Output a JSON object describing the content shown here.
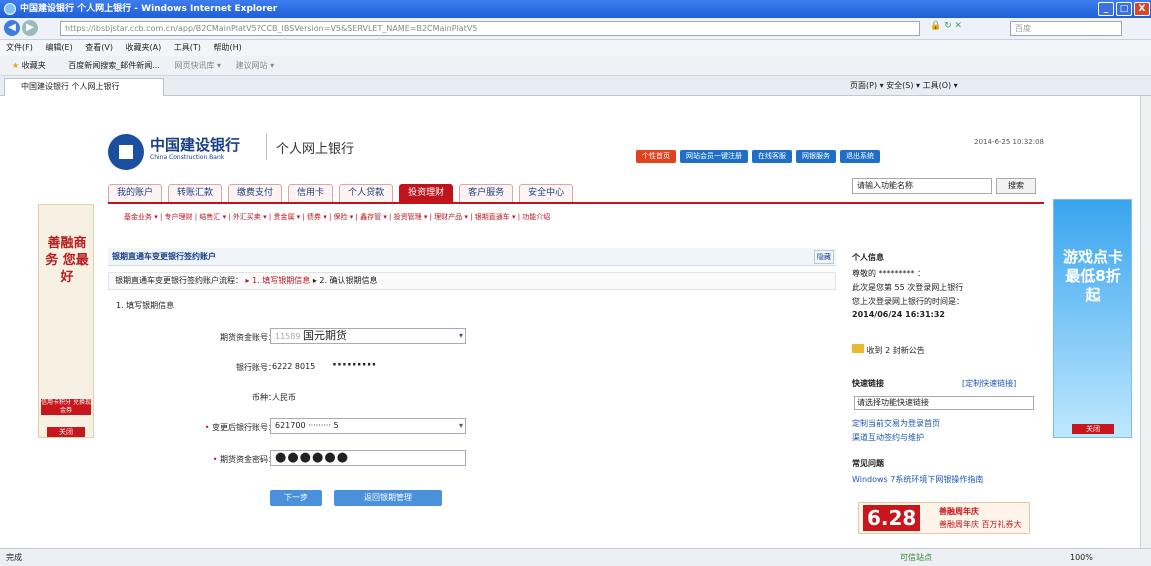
{
  "window": {
    "title": "中国建设银行 个人网上银行 - Windows Internet Explorer",
    "min": "_",
    "max": "□",
    "close": "X"
  },
  "address": {
    "url": "https://ibsbjstar.ccb.com.cn/app/B2CMainPlatV5?CCB_IBSVersion=V5&SERVLET_NAME=B2CMainPlatV5",
    "search_placeholder": "百度"
  },
  "menu": [
    "文件(F)",
    "编辑(E)",
    "查看(V)",
    "收藏夹(A)",
    "工具(T)",
    "帮助(H)"
  ],
  "favorites": {
    "label": "收藏夹",
    "items": [
      "百度新闻搜索_邮件新闻...",
      "网页快讯库 ▾",
      "建议网站 ▾"
    ]
  },
  "tab": {
    "label": "中国建设银行 个人网上银行",
    "tools": "页面(P) ▾  安全(S) ▾  工具(O) ▾"
  },
  "header": {
    "logo_cn": "中国建设银行",
    "logo_en": "China Construction Bank",
    "product": "个人网上银行",
    "datetime": "2014-6-25 10:32:08",
    "links": [
      "个性首页",
      "网站会员一键注册",
      "在线客服",
      "网银服务",
      "退出系统"
    ]
  },
  "mainnav": [
    "我的账户",
    "转账汇款",
    "缴费支付",
    "信用卡",
    "个人贷款",
    "投资理财",
    "客户服务",
    "安全中心"
  ],
  "function_search": {
    "placeholder": "请输入功能名称",
    "button": "搜索"
  },
  "subnav": "基金业务 ▾ | 专户理财 | 结售汇 ▾ | 外汇买卖 ▾ | 贵金属 ▾ | 债券 ▾ | 保险 ▾ | 鑫存管 ▾ | 投资管理 ▾ | 理财产品 ▾ | 银期直通车 ▾ | 功能介绍",
  "form": {
    "section_title": "银期直通车变更银行签约账户",
    "collapse": "隐藏",
    "flow_label": "银期直通车变更银行签约账户流程：",
    "flow_step1": "▸ 1. 填写银期信息",
    "flow_step2": "▸ 2. 确认银期信息",
    "step_title": "1. 填写银期信息",
    "futures_account_label": "期货资金账号：",
    "futures_account_value": "11589",
    "futures_company": "国元期货",
    "bank_account_label": "银行账号：",
    "bank_account_value": "6222 8015",
    "bank_account_mask": "·········",
    "currency_label": "币种：",
    "currency_value": "人民币",
    "new_account_label": "变更后银行账号：",
    "new_account_value": "621700 ········· 5",
    "password_label": "期货资金密码：",
    "password_value": "●●●●●●",
    "next_button": "下一步",
    "back_button": "返回银期管理"
  },
  "personal": {
    "title": "个人信息",
    "greeting": "尊敬的 ********* ：",
    "login_count": "此次是您第 55 次登录网上银行",
    "last_login_label": "您上次登录网上银行的时间是：",
    "last_login_time": "2014/06/24 16:31:32",
    "notice": "收到 2 封新公告"
  },
  "quicklinks": {
    "title": "快速链接",
    "customize": "[定制快速链接]",
    "select": "请选择功能快速链接",
    "link1": "定制当前交易为登录首页",
    "link2": "渠道互动签约与维护"
  },
  "faq": {
    "title": "常见问题",
    "item": "Windows 7系统环境下网银操作指南"
  },
  "promo": {
    "date": "6.28",
    "title": "善融周年庆",
    "sub": "善融周年庆 百万礼券大"
  },
  "leftad": {
    "text": "善融商务 您最好",
    "badge": "信用卡积分 兑换现金券",
    "close": "关闭"
  },
  "rightad": {
    "text": "游戏点卡 最低8折起",
    "close": "关闭"
  },
  "status": {
    "left": "完成",
    "zone": "可信站点",
    "zoom": "100%"
  }
}
